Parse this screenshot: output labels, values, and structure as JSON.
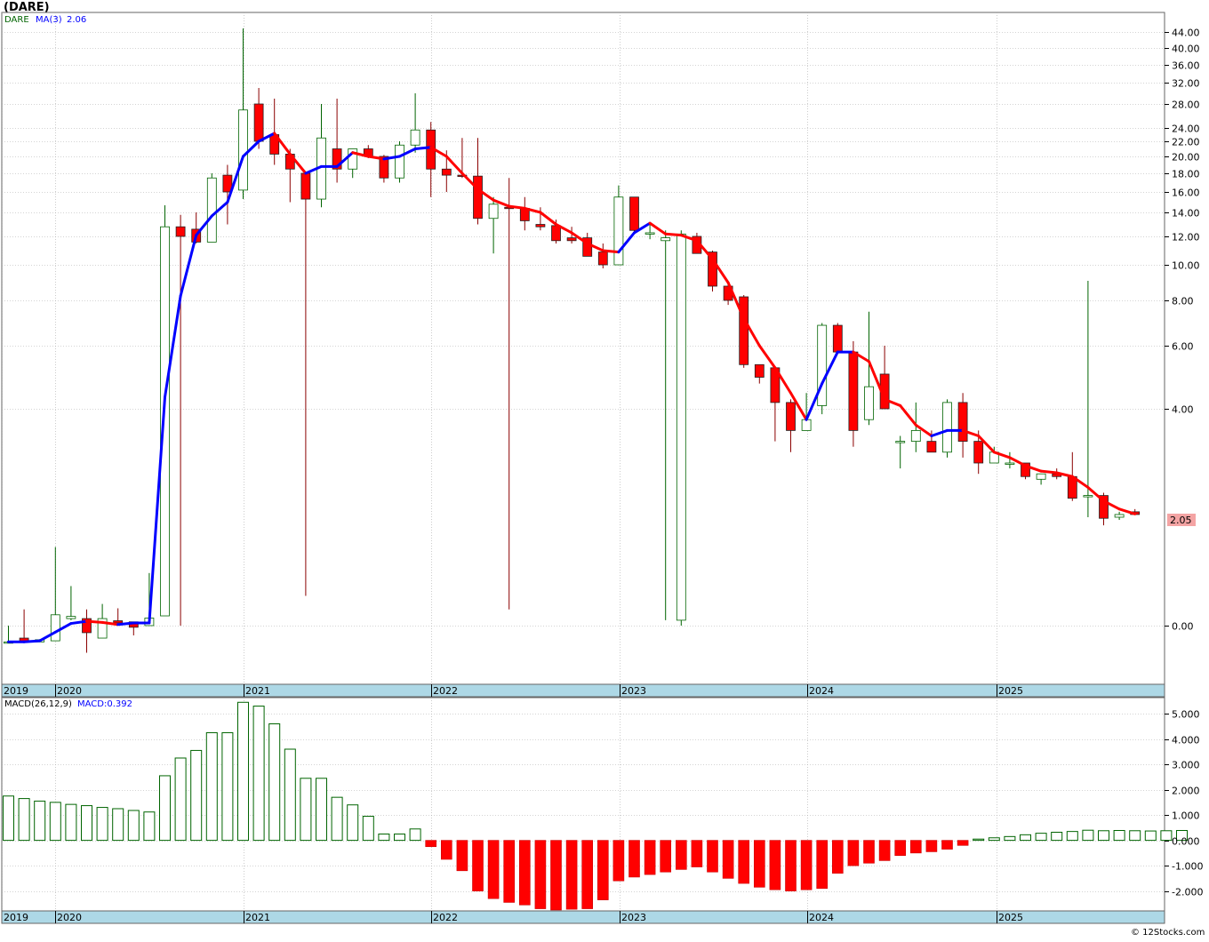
{
  "title": "(DARE)",
  "credit": "© 12Stocks.com",
  "colors": {
    "up": "#006400",
    "down": "#ff0000",
    "ma_up": "#0000ff",
    "ma_down": "#ff0000",
    "macd_up": "#006400",
    "macd_down": "#ff0000",
    "axis_band": "#add8e6",
    "grid": "#aaaaaa",
    "price_tag": "#f4a4a4"
  },
  "legend": {
    "symbol": "DARE",
    "ma_label": "MA(3)",
    "ma_value": "2.06",
    "macd_label": "MACD(26,12,9)",
    "macd_value": "MACD:0.392"
  },
  "last_price_label": "2.05",
  "chart_data": [
    {
      "type": "candlestick",
      "name": "price",
      "interval": "monthly",
      "scale": "custom-compressed",
      "grid": true,
      "y_ticks": [
        "0.00",
        "4.00",
        "6.00",
        "8.00",
        "10.00",
        "12.00",
        "14.00",
        "16.00",
        "18.00",
        "20.00",
        "22.00",
        "24.00",
        "28.00",
        "32.00",
        "36.00",
        "40.00",
        "44.00"
      ],
      "x_year_labels": [
        "2019",
        "2020",
        "2021",
        "2022",
        "2023",
        "2024",
        "2025"
      ],
      "ma_period": 3,
      "candles": [
        {
          "o": -0.3,
          "h": 0.0,
          "l": -0.3,
          "c": -0.3
        },
        {
          "o": -0.23,
          "h": 0.3,
          "l": -0.3,
          "c": -0.3
        },
        {
          "o": -0.3,
          "h": -0.25,
          "l": -0.3,
          "c": -0.26
        },
        {
          "o": -0.28,
          "h": 1.45,
          "l": -0.28,
          "c": 0.2
        },
        {
          "o": 0.13,
          "h": 0.73,
          "l": 0.1,
          "c": 0.17
        },
        {
          "o": 0.13,
          "h": 0.3,
          "l": -0.5,
          "c": -0.13
        },
        {
          "o": -0.23,
          "h": 0.4,
          "l": -0.23,
          "c": 0.13
        },
        {
          "o": 0.09,
          "h": 0.32,
          "l": -0.0,
          "c": 0.05
        },
        {
          "o": 0.07,
          "h": 0.07,
          "l": -0.18,
          "c": -0.03
        },
        {
          "o": 0.0,
          "h": 0.97,
          "l": 0.0,
          "c": 0.14
        },
        {
          "o": 0.18,
          "h": 14.7,
          "l": 0.18,
          "c": 12.8
        },
        {
          "o": 12.8,
          "h": 13.8,
          "l": 0.0,
          "c": 12.0
        },
        {
          "o": 12.6,
          "h": 14.0,
          "l": 11.5,
          "c": 11.6
        },
        {
          "o": 11.6,
          "h": 18.0,
          "l": 11.6,
          "c": 17.5
        },
        {
          "o": 17.8,
          "h": 19.0,
          "l": 13.0,
          "c": 16.0
        },
        {
          "o": 16.2,
          "h": 45.0,
          "l": 15.3,
          "c": 27.0
        },
        {
          "o": 28.0,
          "h": 31.0,
          "l": 21.0,
          "c": 22.0
        },
        {
          "o": 23.0,
          "h": 29.0,
          "l": 19.0,
          "c": 20.3
        },
        {
          "o": 20.3,
          "h": 21.0,
          "l": 15.0,
          "c": 18.5
        },
        {
          "o": 18.0,
          "h": 18.0,
          "l": 0.55,
          "c": 15.3
        },
        {
          "o": 15.3,
          "h": 28.0,
          "l": 14.5,
          "c": 22.5
        },
        {
          "o": 21.0,
          "h": 29.0,
          "l": 17.0,
          "c": 18.5
        },
        {
          "o": 18.5,
          "h": 21.0,
          "l": 17.5,
          "c": 21.0
        },
        {
          "o": 21.0,
          "h": 21.5,
          "l": 19.8,
          "c": 20.0
        },
        {
          "o": 20.0,
          "h": 20.2,
          "l": 17.0,
          "c": 17.5
        },
        {
          "o": 17.5,
          "h": 22.0,
          "l": 17.0,
          "c": 21.5
        },
        {
          "o": 21.5,
          "h": 30.0,
          "l": 20.5,
          "c": 23.7
        },
        {
          "o": 23.7,
          "h": 25.0,
          "l": 15.5,
          "c": 18.5
        },
        {
          "o": 18.5,
          "h": 20.8,
          "l": 16.0,
          "c": 17.8
        },
        {
          "o": 17.8,
          "h": 22.5,
          "l": 17.5,
          "c": 17.7
        },
        {
          "o": 17.7,
          "h": 22.5,
          "l": 13.0,
          "c": 13.5
        },
        {
          "o": 13.5,
          "h": 15.5,
          "l": 10.8,
          "c": 14.8
        },
        {
          "o": 14.5,
          "h": 17.5,
          "l": 0.3,
          "c": 14.4
        },
        {
          "o": 14.4,
          "h": 15.5,
          "l": 12.5,
          "c": 13.3
        },
        {
          "o": 13.0,
          "h": 14.5,
          "l": 12.5,
          "c": 12.8
        },
        {
          "o": 12.9,
          "h": 13.4,
          "l": 11.5,
          "c": 11.7
        },
        {
          "o": 11.9,
          "h": 12.8,
          "l": 11.5,
          "c": 11.7
        },
        {
          "o": 11.9,
          "h": 12.3,
          "l": 10.7,
          "c": 10.6
        },
        {
          "o": 10.9,
          "h": 11.5,
          "l": 9.8,
          "c": 10.0
        },
        {
          "o": 10.0,
          "h": 16.7,
          "l": 10.0,
          "c": 15.5
        },
        {
          "o": 15.5,
          "h": 15.5,
          "l": 12.3,
          "c": 12.5
        },
        {
          "o": 12.3,
          "h": 13.0,
          "l": 11.8,
          "c": 12.3
        },
        {
          "o": 11.7,
          "h": 12.5,
          "l": 0.1,
          "c": 11.9
        },
        {
          "o": 0.1,
          "h": 12.5,
          "l": -0.0,
          "c": 12.2
        },
        {
          "o": 12.0,
          "h": 12.3,
          "l": 11.0,
          "c": 10.8
        },
        {
          "o": 10.9,
          "h": 11.0,
          "l": 8.5,
          "c": 8.8
        },
        {
          "o": 8.8,
          "h": 8.9,
          "l": 7.8,
          "c": 8.0
        },
        {
          "o": 8.2,
          "h": 8.3,
          "l": 5.3,
          "c": 5.4
        },
        {
          "o": 5.4,
          "h": 5.4,
          "l": 4.8,
          "c": 5.0
        },
        {
          "o": 5.3,
          "h": 5.3,
          "l": 3.4,
          "c": 4.2
        },
        {
          "o": 4.2,
          "h": 4.3,
          "l": 3.2,
          "c": 3.6
        },
        {
          "o": 3.6,
          "h": 4.5,
          "l": 3.6,
          "c": 3.8
        },
        {
          "o": 4.1,
          "h": 7.0,
          "l": 3.9,
          "c": 6.9
        },
        {
          "o": 6.9,
          "h": 7.0,
          "l": 5.8,
          "c": 5.8
        },
        {
          "o": 5.8,
          "h": 6.2,
          "l": 3.3,
          "c": 3.6
        },
        {
          "o": 3.8,
          "h": 7.5,
          "l": 3.7,
          "c": 4.7
        },
        {
          "o": 5.1,
          "h": 6.0,
          "l": 4.0,
          "c": 4.0
        },
        {
          "o": 3.4,
          "h": 3.5,
          "l": 2.9,
          "c": 3.4
        },
        {
          "o": 3.4,
          "h": 4.2,
          "l": 3.2,
          "c": 3.6
        },
        {
          "o": 3.4,
          "h": 3.6,
          "l": 3.2,
          "c": 3.2
        },
        {
          "o": 3.2,
          "h": 4.3,
          "l": 3.1,
          "c": 4.2
        },
        {
          "o": 4.2,
          "h": 4.5,
          "l": 3.1,
          "c": 3.4
        },
        {
          "o": 3.4,
          "h": 3.6,
          "l": 2.8,
          "c": 3.0
        },
        {
          "o": 3.0,
          "h": 3.3,
          "l": 3.0,
          "c": 3.2
        },
        {
          "o": 3.0,
          "h": 3.2,
          "l": 2.9,
          "c": 3.0
        },
        {
          "o": 3.0,
          "h": 3.0,
          "l": 2.7,
          "c": 2.75
        },
        {
          "o": 2.7,
          "h": 2.8,
          "l": 2.6,
          "c": 2.8
        },
        {
          "o": 2.8,
          "h": 2.9,
          "l": 2.7,
          "c": 2.75
        },
        {
          "o": 2.75,
          "h": 3.2,
          "l": 2.3,
          "c": 2.35
        },
        {
          "o": 2.4,
          "h": 9.1,
          "l": 2.0,
          "c": 2.4
        },
        {
          "o": 2.4,
          "h": 2.45,
          "l": 1.85,
          "c": 1.98
        },
        {
          "o": 2.0,
          "h": 2.1,
          "l": 1.95,
          "c": 2.05
        },
        {
          "o": 2.1,
          "h": 2.15,
          "l": 2.05,
          "c": 2.05
        }
      ],
      "ma_values": [
        -0.3,
        -0.3,
        -0.28,
        -0.12,
        0.04,
        0.08,
        0.06,
        0.02,
        0.05,
        0.05,
        4.37,
        8.25,
        12.1,
        13.7,
        15.0,
        20.0,
        22.0,
        23.2,
        20.3,
        18.0,
        18.8,
        18.8,
        20.5,
        20.0,
        19.7,
        20.0,
        21.0,
        21.2,
        20.0,
        18.0,
        16.3,
        15.2,
        14.6,
        14.4,
        14.0,
        13.0,
        12.3,
        11.5,
        11.0,
        10.9,
        12.3,
        13.1,
        12.2,
        12.1,
        11.7,
        10.4,
        9.0,
        7.2,
        6.0,
        5.3,
        4.5,
        3.8,
        4.8,
        5.8,
        5.8,
        5.5,
        4.3,
        4.1,
        3.7,
        3.5,
        3.6,
        3.6,
        3.5,
        3.2,
        3.1,
        2.95,
        2.85,
        2.82,
        2.75,
        2.55,
        2.3,
        2.15,
        2.06
      ]
    },
    {
      "type": "bar",
      "name": "MACD(26,12,9)",
      "grid": true,
      "y_ticks": [
        "-2.000",
        "-1.000",
        "0.000",
        "1.000",
        "2.000",
        "3.000",
        "4.000",
        "5.000"
      ],
      "ylim": [
        -2.75,
        5.6
      ],
      "x_year_labels": [
        "2019",
        "2020",
        "2021",
        "2022",
        "2023",
        "2024",
        "2025"
      ],
      "values": [
        1.75,
        1.65,
        1.55,
        1.5,
        1.42,
        1.37,
        1.3,
        1.25,
        1.18,
        1.12,
        2.55,
        3.25,
        3.55,
        4.25,
        4.25,
        5.45,
        5.3,
        4.6,
        3.6,
        2.45,
        2.45,
        1.7,
        1.4,
        0.95,
        0.25,
        0.25,
        0.45,
        -0.25,
        -0.75,
        -1.2,
        -2.0,
        -2.3,
        -2.45,
        -2.55,
        -2.7,
        -2.75,
        -2.72,
        -2.7,
        -2.35,
        -1.6,
        -1.45,
        -1.35,
        -1.25,
        -1.15,
        -1.05,
        -1.25,
        -1.5,
        -1.7,
        -1.85,
        -1.95,
        -2.0,
        -1.95,
        -1.9,
        -1.3,
        -1.0,
        -0.9,
        -0.8,
        -0.6,
        -0.5,
        -0.45,
        -0.35,
        -0.2,
        0.05,
        0.1,
        0.15,
        0.22,
        0.28,
        0.32,
        0.35,
        0.4,
        0.38,
        0.39,
        0.38,
        0.37,
        0.38,
        0.39
      ]
    }
  ]
}
